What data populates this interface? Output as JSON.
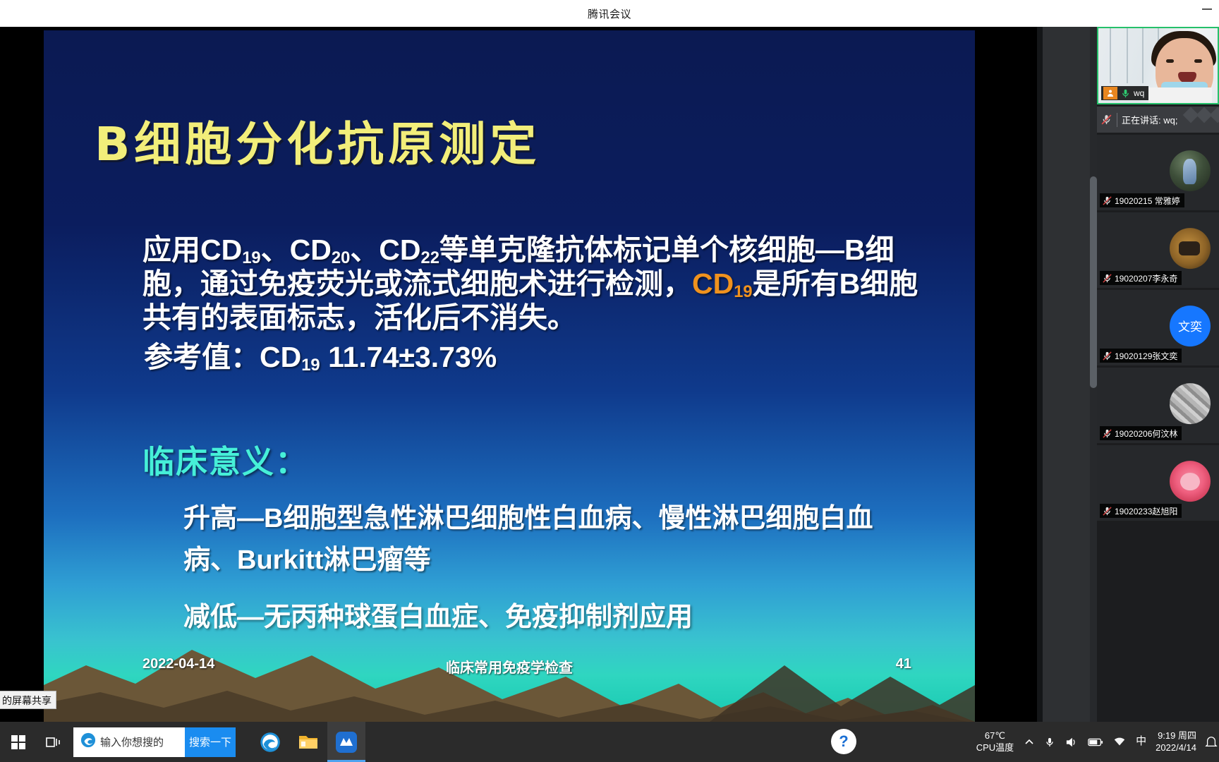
{
  "window": {
    "title": "腾讯会议",
    "minimize_icon": "minimize-icon"
  },
  "slide": {
    "title": "B细胞分化抗原测定",
    "paragraph_prefix": "应用CD",
    "cd_19": "19",
    "sep1": "、CD",
    "cd_20": "20",
    "sep2": "、CD",
    "cd_22": "22",
    "paragraph_mid": "等单克隆抗体标记单个核细胞—B细胞，通过免疫荧光或流式细胞术进行检测，",
    "highlight_cd": "CD",
    "highlight_sub": "19",
    "paragraph_tail": "是所有B细胞共有的表面标志，活化后不消失。",
    "reference_label": "参考值：",
    "reference_cd": "CD",
    "reference_sub": "19",
    "reference_value": "11.74±3.73%",
    "section_title": "临床意义：",
    "bullet_increase": "升高—B细胞型急性淋巴细胞性白血病、慢性淋巴细胞白血病、Burkitt淋巴瘤等",
    "bullet_decrease": "减低—无丙种球蛋白血症、免疫抑制剂应用",
    "footer_date": "2022-04-14",
    "footer_center": "临床常用免疫学检查",
    "footer_page": "41",
    "colors": {
      "title": "#F2EE7A",
      "section": "#46F0D8",
      "highlight": "#F0921E",
      "background_top": "#0B1A52",
      "background_bottom": "#16C8B0"
    }
  },
  "share_tag": {
    "text": "的屏幕共享"
  },
  "speaking": {
    "status": "正在讲话: wq;",
    "mic_icon": "mic-muted-icon"
  },
  "participants": [
    {
      "name": "wq",
      "active": true,
      "mic": "mic-on-icon",
      "badge": "user-orange-icon",
      "avatar_type": "video"
    },
    {
      "name": "19020215 常雅婷",
      "active": false,
      "mic": "mic-muted-icon",
      "avatar_type": "photo1"
    },
    {
      "name": "19020207李永奇",
      "active": false,
      "mic": "mic-muted-icon",
      "avatar_type": "photo2"
    },
    {
      "name": "19020129张文奕",
      "active": false,
      "mic": "mic-muted-icon",
      "avatar_type": "initials",
      "avatar_text": "文奕",
      "avatar_color": "#1677FF"
    },
    {
      "name": "19020206何汶林",
      "active": false,
      "mic": "mic-muted-icon",
      "avatar_type": "photo3"
    },
    {
      "name": "19020233赵旭阳",
      "active": false,
      "mic": "mic-muted-icon",
      "avatar_type": "photo4"
    }
  ],
  "taskbar": {
    "start_icon": "windows-start-icon",
    "taskview_icon": "task-view-icon",
    "search_placeholder": "输入你想搜的",
    "search_button": "搜索一下",
    "apps": [
      {
        "name": "edge-browser",
        "icon": "edge-icon"
      },
      {
        "name": "file-explorer",
        "icon": "folder-icon"
      },
      {
        "name": "tencent-meeting",
        "icon": "tencent-meeting-icon"
      }
    ],
    "help_icon": "question-mark-icon",
    "temperature": "67℃",
    "temperature_label": "CPU温度",
    "chevron_icon": "chevron-up-icon",
    "mic_icon": "mic-icon",
    "volume_icon": "volume-icon",
    "battery_icon": "battery-icon",
    "network_icon": "network-icon",
    "ime_label": "中",
    "clock_time": "9:19 周四",
    "clock_date": "2022/4/14",
    "notification_icon": "notification-icon"
  }
}
